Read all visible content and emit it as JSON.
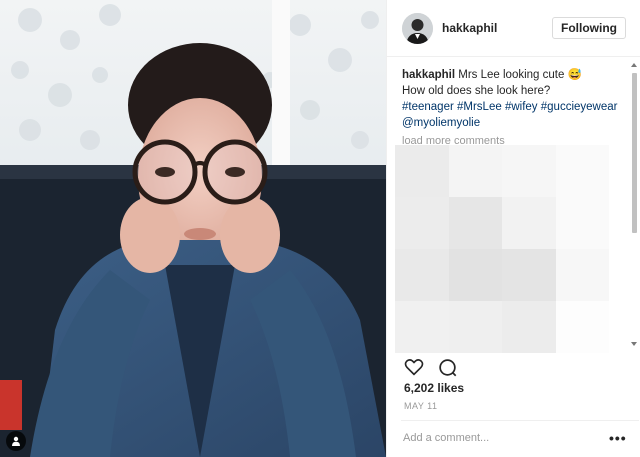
{
  "post": {
    "author": "hakkaphil",
    "follow_label": "Following",
    "caption": {
      "username": "hakkaphil",
      "line1": " Mrs Lee looking cute 😅",
      "line2": "How old does she look here?",
      "hashtags": [
        "#teenager",
        "#MrsLee",
        "#wifey",
        "#guccieyewear"
      ],
      "mention": "@myoliemyolie"
    },
    "load_more_label": "load more comments",
    "likes_text": "6,202 likes",
    "date_text": "MAY 11",
    "add_comment_placeholder": "Add a comment...",
    "more_options": "•••"
  },
  "icons": {
    "like": "heart-outline-icon",
    "comment": "speech-bubble-icon",
    "user_tag": "person-icon"
  },
  "colors": {
    "hashtag": "#003569",
    "muted": "#999999",
    "text": "#262626"
  }
}
